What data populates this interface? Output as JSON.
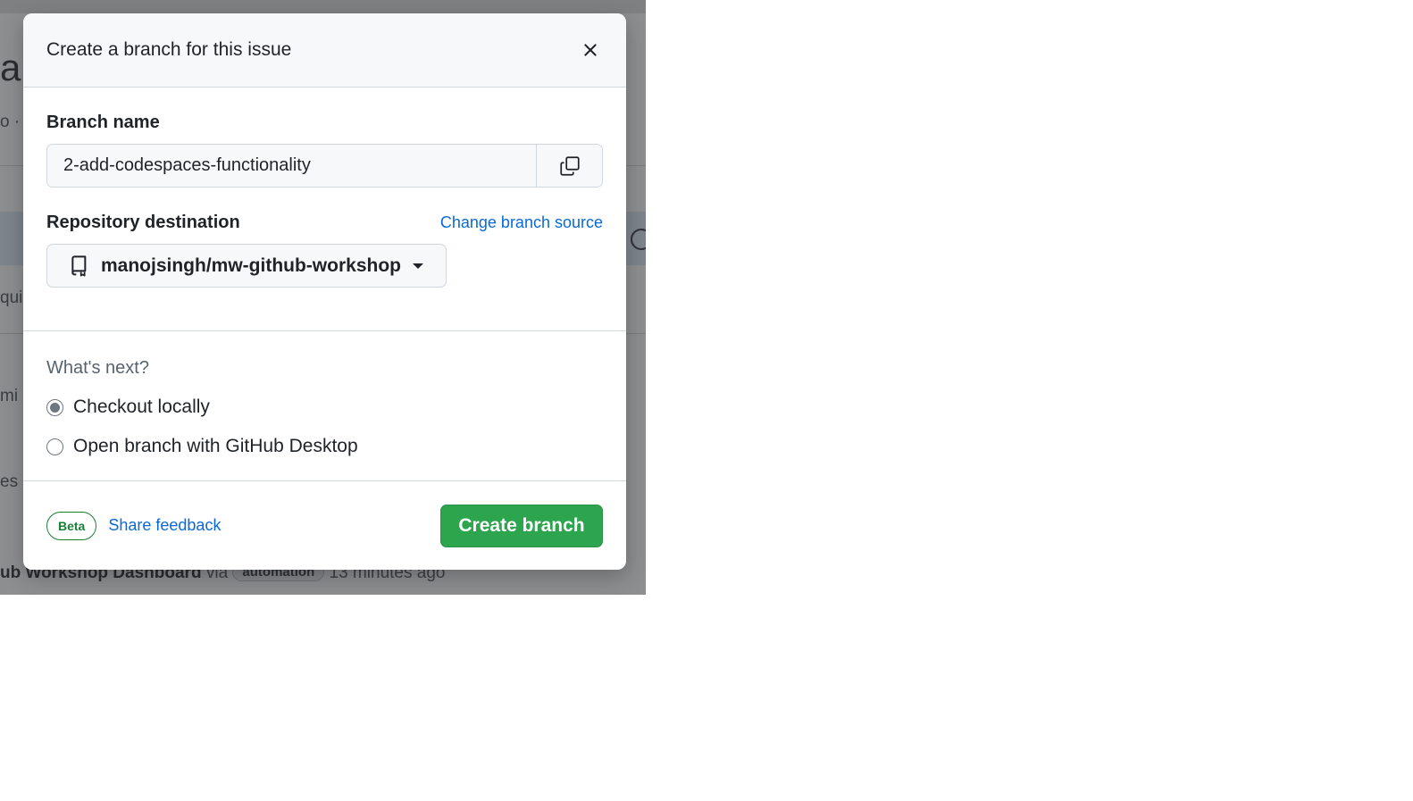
{
  "background": {
    "heading_fragment": "a",
    "meta_fragment": "o ·",
    "line_fragment_1": "qui",
    "line_fragment_2": "mi",
    "line_fragment_3": "es a",
    "footer": {
      "author": "ub Workshop Dashboard",
      "via": "via",
      "badge": "automation",
      "time": "13 minutes ago"
    }
  },
  "dialog": {
    "title": "Create a branch for this issue",
    "branch_name_label": "Branch name",
    "branch_name_value": "2-add-codespaces-functionality",
    "repo_label": "Repository destination",
    "change_source_link": "Change branch source",
    "repo_value": "manojsingh/mw-github-workshop",
    "whats_next_label": "What's next?",
    "options": [
      {
        "label": "Checkout locally",
        "checked": true
      },
      {
        "label": "Open branch with GitHub Desktop",
        "checked": false
      }
    ],
    "beta_badge": "Beta",
    "feedback_link": "Share feedback",
    "create_button": "Create branch"
  },
  "colors": {
    "primary_button": "#2da44e",
    "link": "#0969da",
    "beta": "#1a7f37"
  },
  "icons": {
    "close": "close-icon",
    "copy": "copy-icon",
    "repo": "repo-icon",
    "caret": "caret-down-icon"
  }
}
